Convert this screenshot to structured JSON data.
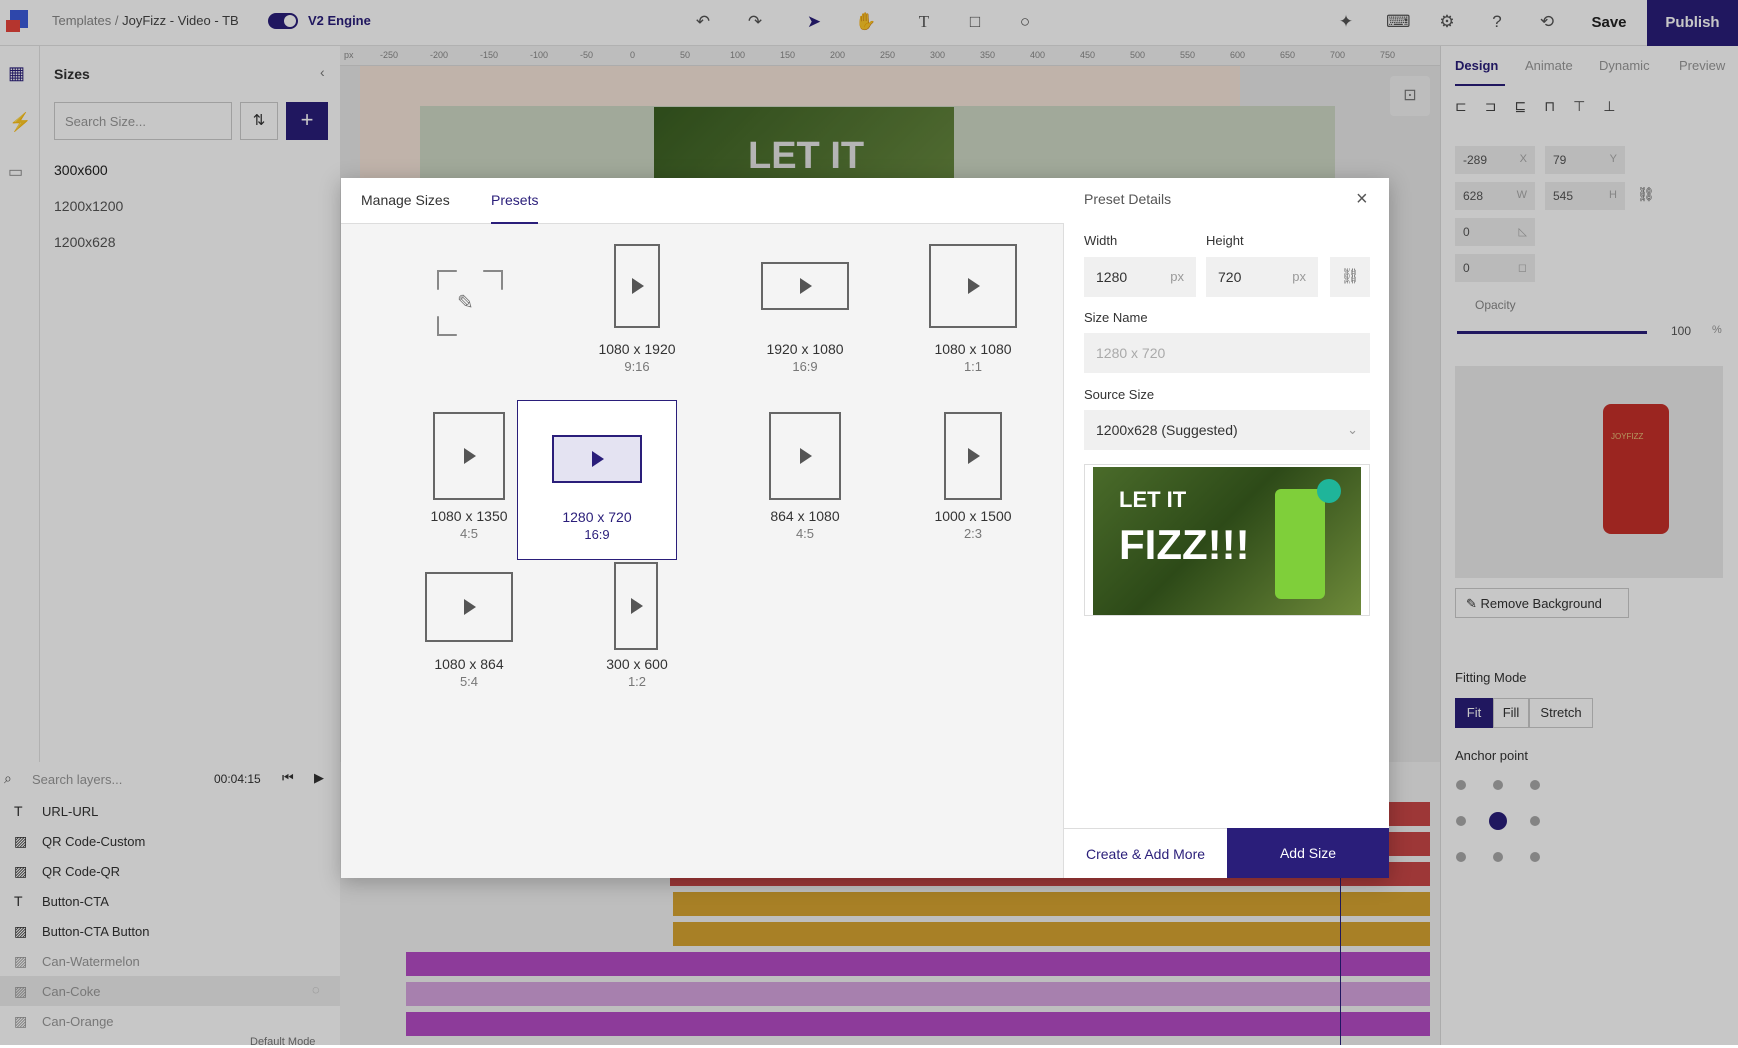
{
  "topbar": {
    "breadcrumb_root": "Templates",
    "breadcrumb_sep": "/",
    "breadcrumb_current": "JoyFizz - Video - TB",
    "engine_label": "V2 Engine",
    "save_label": "Save",
    "publish_label": "Publish"
  },
  "sizes_panel": {
    "title": "Sizes",
    "search_placeholder": "Search Size...",
    "items": [
      "300x600",
      "1200x1200",
      "1200x628"
    ]
  },
  "layers": {
    "search_placeholder": "Search layers...",
    "timecode": "00:04:15",
    "rows": [
      {
        "name": "URL-URL",
        "icon": "text-icon"
      },
      {
        "name": "QR Code-Custom",
        "icon": "image-icon"
      },
      {
        "name": "QR Code-QR",
        "icon": "image-icon"
      },
      {
        "name": "Button-CTA",
        "icon": "text-icon"
      },
      {
        "name": "Button-CTA Button",
        "icon": "image-icon"
      },
      {
        "name": "Can-Watermelon",
        "icon": "image-icon"
      },
      {
        "name": "Can-Coke",
        "icon": "image-icon"
      },
      {
        "name": "Can-Orange",
        "icon": "image-icon"
      }
    ],
    "footer": "Default Mode"
  },
  "ruler": {
    "unit": "px",
    "ticks": [
      "-250",
      "-200",
      "-150",
      "-100",
      "-50",
      "0",
      "50",
      "100",
      "150",
      "200",
      "250",
      "300",
      "350",
      "400",
      "450",
      "500",
      "550",
      "600",
      "650",
      "700",
      "750"
    ]
  },
  "canvas": {
    "headline": "LET IT"
  },
  "right_panel": {
    "tabs": [
      "Design",
      "Animate",
      "Dynamic",
      "Preview"
    ],
    "x": "-289",
    "y": "79",
    "w": "628",
    "h": "545",
    "rotation": "0",
    "radius": "0",
    "opacity_label": "Opacity",
    "opacity_value": "100",
    "opacity_unit": "%",
    "remove_bg": "Remove Background",
    "fitting_label": "Fitting Mode",
    "fitting_options": [
      "Fit",
      "Fill",
      "Stretch"
    ],
    "anchor_label": "Anchor point",
    "can_brand": "JOYFIZZ"
  },
  "modal": {
    "tabs": [
      "Manage Sizes",
      "Presets"
    ],
    "presets": [
      {
        "label": "1080 x 1920",
        "ratio": "9:16"
      },
      {
        "label": "1920 x 1080",
        "ratio": "16:9"
      },
      {
        "label": "1080 x 1080",
        "ratio": "1:1"
      },
      {
        "label": "1080 x 1350",
        "ratio": "4:5"
      },
      {
        "label": "1280 x 720",
        "ratio": "16:9"
      },
      {
        "label": "864 x 1080",
        "ratio": "4:5"
      },
      {
        "label": "1000 x 1500",
        "ratio": "2:3"
      },
      {
        "label": "1080 x 864",
        "ratio": "5:4"
      },
      {
        "label": "300 x 600",
        "ratio": "1:2"
      }
    ],
    "details": {
      "title": "Preset Details",
      "width_label": "Width",
      "width_value": "1280",
      "width_unit": "px",
      "height_label": "Height",
      "height_value": "720",
      "height_unit": "px",
      "name_label": "Size Name",
      "name_placeholder": "1280 x 720",
      "source_label": "Source Size",
      "source_value": "1200x628 (Suggested)",
      "preview_line1": "LET IT",
      "preview_line2": "FIZZ!!!",
      "create_more": "Create & Add More",
      "add_size": "Add Size"
    }
  }
}
